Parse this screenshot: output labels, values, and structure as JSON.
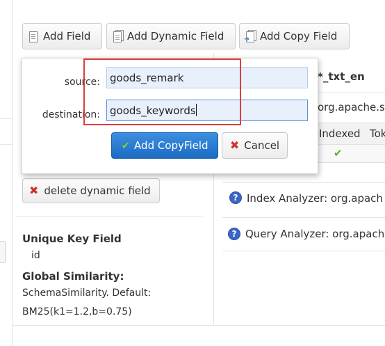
{
  "toolbar": {
    "add_field_label": "Add Field",
    "add_dynamic_field_label": "Add Dynamic Field",
    "add_copy_field_label": "Add Copy Field"
  },
  "copy_field_dialog": {
    "source_label": "source:",
    "source_value": "goods_remark",
    "destination_label": "destination:",
    "destination_value": "goods_keywords",
    "add_button_label": "Add CopyField",
    "cancel_button_label": "Cancel",
    "highlight_color": "#e43a3a"
  },
  "schema_panel": {
    "field_name": "*_txt_en",
    "class_name": "org.apache.so",
    "table_headers": [
      "Indexed",
      "Tok"
    ],
    "indexed_checked": true,
    "index_analyzer": "Index Analyzer: org.apach",
    "query_analyzer": "Query Analyzer: org.apach"
  },
  "left_panel": {
    "delete_dynamic_field_label": "delete dynamic field",
    "unique_key_title": "Unique Key Field",
    "unique_key_value": "id",
    "global_similarity_title": "Global Similarity:",
    "global_similarity_line1": "SchemaSimilarity. Default:",
    "global_similarity_line2": "BM25(k1=1.2,b=0.75)"
  },
  "colors": {
    "primary_button": "#1c6bc4",
    "help_icon": "#3b66c8",
    "delete_icon": "#d0342c"
  }
}
